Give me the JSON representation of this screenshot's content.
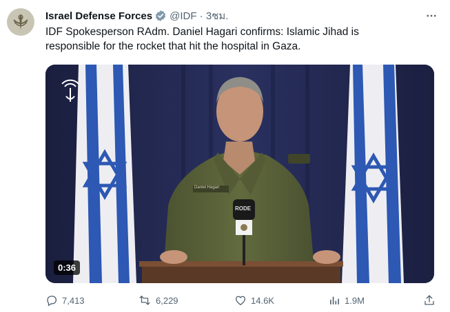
{
  "tweet": {
    "author_name": "Israel Defense Forces",
    "handle": "@IDF · 3ชม.",
    "text": "IDF Spokesperson RAdm. Daniel Hagari confirms: Islamic Jihad is responsible for the rocket that hit the hospital in Gaza.",
    "verified": true
  },
  "media": {
    "type": "video",
    "duration": "0:36",
    "name_tag": "Daniel Hagari",
    "mic_label": "RODE"
  },
  "actions": {
    "replies": "7,413",
    "reposts": "6,229",
    "likes": "14.6K",
    "views": "1.9M"
  },
  "colors": {
    "verified_badge": "#829aab",
    "muted_text": "#536471",
    "flag_blue": "#1f4fa8"
  },
  "icons": [
    "more-icon",
    "verified-badge-icon",
    "reply-icon",
    "repost-icon",
    "like-icon",
    "views-icon",
    "share-icon",
    "idf-logo-icon"
  ]
}
